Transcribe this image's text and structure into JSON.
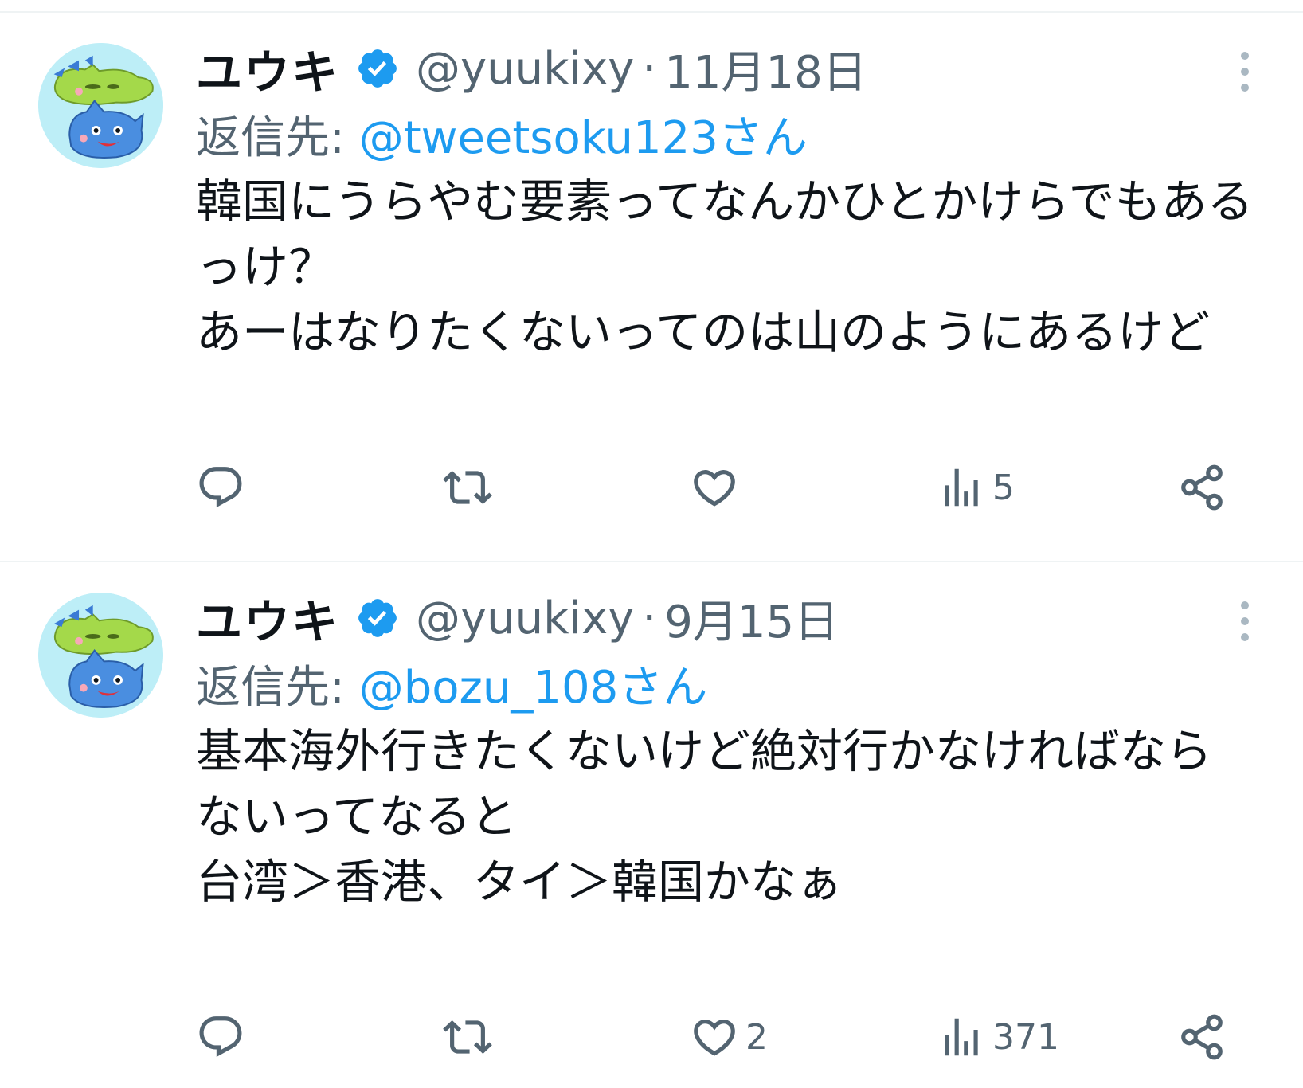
{
  "tweets": [
    {
      "display_name": "ユウキ",
      "handle": "@yuukixy",
      "separator": "·",
      "date": "11月18日",
      "reply_prefix": "返信先:",
      "reply_mention": "@tweetsoku123さん",
      "text": "韓国にうらやむ要素ってなんかひとかけらでもあるっけ？\nあーはなりたくないってのは山のようにあるけど",
      "actions": {
        "reply_count": "",
        "retweet_count": "",
        "like_count": "",
        "views_count": "5"
      }
    },
    {
      "display_name": "ユウキ",
      "handle": "@yuukixy",
      "separator": "·",
      "date": "9月15日",
      "reply_prefix": "返信先:",
      "reply_mention": "@bozu_108さん",
      "text": "基本海外行きたくないけど絶対行かなければならないってなると\n台湾＞香港、タイ＞韓国かなぁ",
      "actions": {
        "reply_count": "",
        "retweet_count": "",
        "like_count": "2",
        "views_count": "371"
      }
    }
  ],
  "colors": {
    "primary_text": "#0f1419",
    "secondary_text": "#536471",
    "mention": "#1d9bf0",
    "verified_badge": "#1d9bf0",
    "avatar_bg": "#bdeef7",
    "divider": "#eff3f4"
  },
  "icons": {
    "verified": "verified-badge-icon",
    "more": "more-vertical-icon",
    "reply": "reply-bubble-icon",
    "retweet": "retweet-icon",
    "like": "heart-icon",
    "views": "analytics-bars-icon",
    "share": "share-icon"
  }
}
